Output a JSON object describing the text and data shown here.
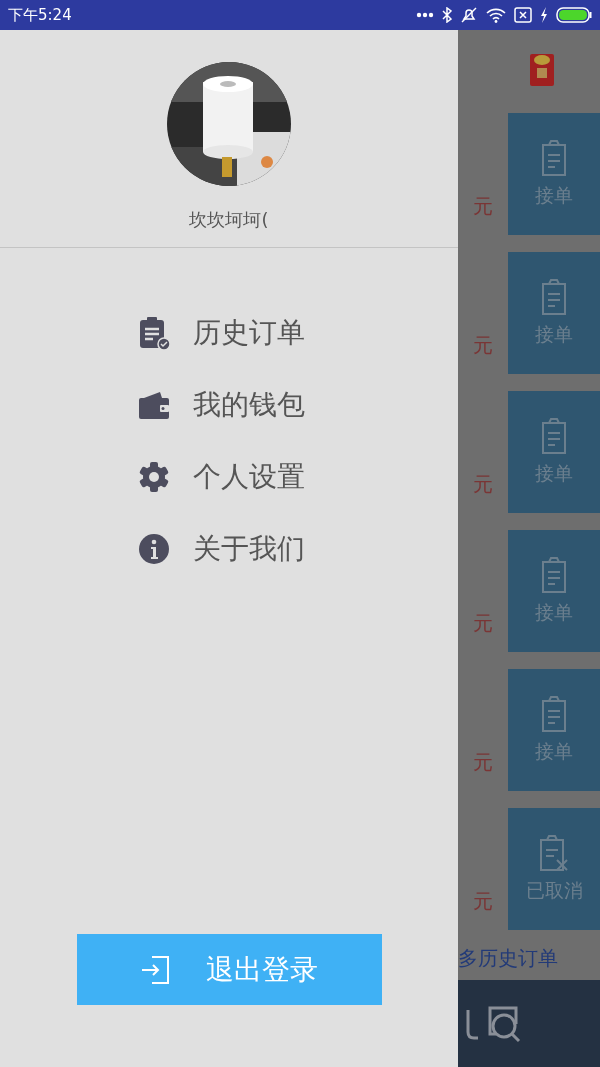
{
  "status_bar": {
    "time": "下午5:24"
  },
  "drawer": {
    "username": "坎坎坷坷(",
    "menu": [
      {
        "kind": "history",
        "label": "历史订单"
      },
      {
        "kind": "wallet",
        "label": "我的钱包"
      },
      {
        "kind": "settings",
        "label": "个人设置"
      },
      {
        "kind": "about",
        "label": "关于我们"
      }
    ],
    "logout_button": "退出登录"
  },
  "orders": [
    {
      "unit": "元",
      "action": "接单",
      "kind": "accept"
    },
    {
      "unit": "元",
      "action": "接单",
      "kind": "accept"
    },
    {
      "unit": "元",
      "action": "接单",
      "kind": "accept"
    },
    {
      "unit": "元",
      "action": "接单",
      "kind": "accept"
    },
    {
      "unit": "元",
      "action": "接单",
      "kind": "accept"
    },
    {
      "unit": "元",
      "action": "已取消",
      "kind": "cancelled"
    }
  ],
  "more_link": "多历史订单"
}
